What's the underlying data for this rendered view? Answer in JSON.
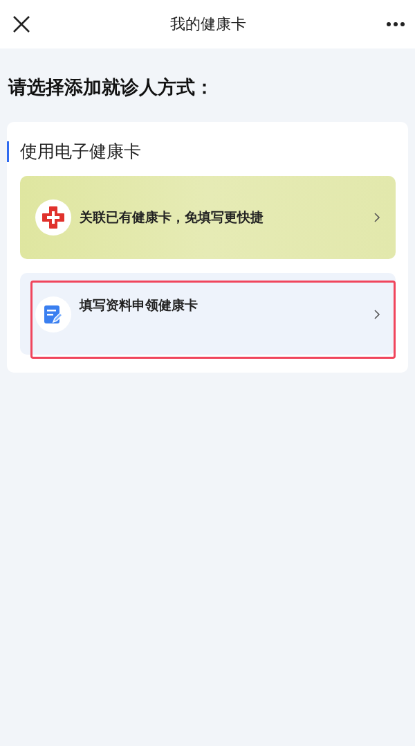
{
  "header": {
    "title": "我的健康卡"
  },
  "heading": "请选择添加就诊人方式：",
  "section": {
    "title": "使用电子健康卡",
    "options": [
      {
        "kind": "link",
        "label": "关联已有健康卡，免填写更快捷",
        "highlighted": false
      },
      {
        "kind": "apply",
        "label": "填写资料申领健康卡",
        "highlighted": true
      }
    ]
  }
}
